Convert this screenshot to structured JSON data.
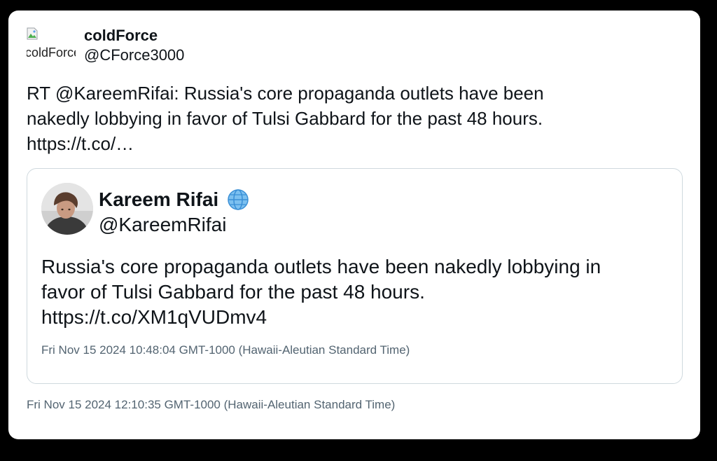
{
  "retweeter": {
    "display_name": "coldForce",
    "handle": "@CForce3000",
    "avatar_alt": "coldForce"
  },
  "tweet": {
    "text_lines": [
      "RT @KareemRifai: Russia's core propaganda outlets have been",
      "nakedly lobbying in favor of Tulsi Gabbard for the past 48 hours.",
      "https://t.co/…"
    ],
    "timestamp": "Fri Nov 15 2024 12:10:35 GMT-1000 (Hawaii-Aleutian Standard Time)"
  },
  "quoted": {
    "display_name": "Kareem Rifai",
    "badge_icon": "globe-icon",
    "handle": "@KareemRifai",
    "text_lines": [
      "Russia's core propaganda outlets have been nakedly lobbying in",
      "favor of Tulsi Gabbard for the past 48 hours.",
      "https://t.co/XM1qVUDmv4"
    ],
    "timestamp": "Fri Nov 15 2024 10:48:04 GMT-1000 (Hawaii-Aleutian Standard Time)"
  },
  "colors": {
    "background": "#000000",
    "card": "#ffffff",
    "text": "#0f1419",
    "muted": "#536471",
    "border": "#cfd9de"
  }
}
